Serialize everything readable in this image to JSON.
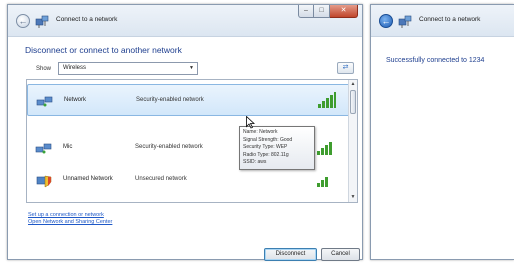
{
  "window1": {
    "title": "Connect to a network",
    "heading": "Disconnect or connect to another network",
    "show_label": "Show",
    "show_value": "Wireless",
    "networks": [
      {
        "name": "Network",
        "security": "Security-enabled network",
        "icon": "wireless-network-icon",
        "signal": 5,
        "selected": true
      },
      {
        "name": "Mic",
        "security": "Security-enabled network",
        "icon": "wireless-network-icon",
        "signal": 4,
        "selected": false
      },
      {
        "name": "Unnamed Network",
        "security": "Unsecured network",
        "icon": "unsecured-network-shield-icon",
        "signal": 3,
        "selected": false
      }
    ],
    "tooltip": {
      "lines": [
        "Name: Network",
        "Signal Strength: Good",
        "Security Type: WEP",
        "Radio Type: 802.11g",
        "SSID: aws"
      ]
    },
    "links": [
      "Set up a connection or network",
      "Open Network and Sharing Center"
    ],
    "buttons": {
      "disconnect": "Disconnect",
      "cancel": "Cancel"
    }
  },
  "window2": {
    "title": "Connect to a network",
    "message": "Successfully connected to 1234"
  },
  "colors": {
    "link": "#1e58c7",
    "heading": "#1f3f8f",
    "signal": "#3f9d2f",
    "selected_bg": "#d2e7fa"
  }
}
